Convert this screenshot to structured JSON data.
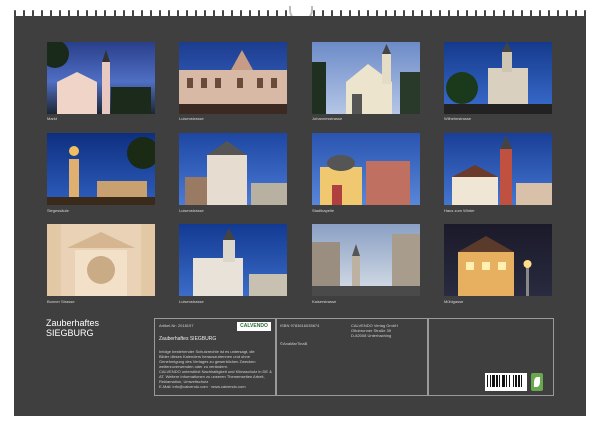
{
  "calendar_title": {
    "line1": "Zauberhaftes",
    "line2": "SIEGBURG"
  },
  "photos": [
    {
      "caption": "Markt"
    },
    {
      "caption": "Luisenstrasse"
    },
    {
      "caption": "Johannesstrasse"
    },
    {
      "caption": "Wilhelmstrasse"
    },
    {
      "caption": "Siegessäule"
    },
    {
      "caption": "Luisenstrasse"
    },
    {
      "caption": "Stadtkapelle"
    },
    {
      "caption": "Haus zum Winter"
    },
    {
      "caption": "Bonner Strasse"
    },
    {
      "caption": "Luisenstrasse"
    },
    {
      "caption": "Kaiserstrasse"
    },
    {
      "caption": "Mühlgasse"
    }
  ],
  "info": {
    "article_no": "Artikel-Nr: 2018197",
    "product_title": "Zauberhaftes SIEGBURG",
    "description": [
      "Infolge bestehender Schutzrechte ist es untersagt, die",
      "Bilder dieses Kalenders herauszutrennen und ohne",
      "Genehmigung des Verlages zu gewerblichen Zwecken",
      "weiterzuverwenden oder zu verändern.",
      "CALVENDO unterstützt Nachhaltigkeit und Klimaschutz in DE &",
      "AT. Weitere Informationen zu unseren Themenseiten Arbeit,",
      "Reklamation, Umweltschutz",
      "E-Mail: info@calvendo.com · www.calvendo.com"
    ],
    "isbn": "ISBN 9783616035674",
    "author_line": "©AnaMarTinaB",
    "publisher": [
      "CALVENDO Verlag GmbH",
      "Ottobrunner Straße 39",
      "D-82008 Unterhaching"
    ],
    "logo": "CALVENDO"
  }
}
